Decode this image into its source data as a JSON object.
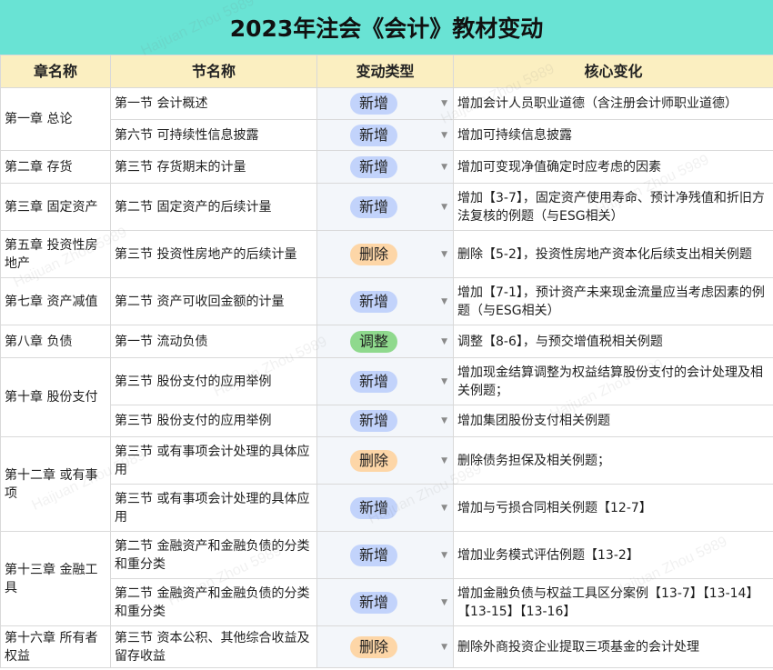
{
  "title": "2023年注会《会计》教材变动",
  "headers": [
    "章名称",
    "节名称",
    "变动类型",
    "核心变化"
  ],
  "watermark": "Haijuan Zhou 5989",
  "rows": [
    {
      "chapter": "第一章  总论",
      "rowspan": 2,
      "section": "第一节  会计概述",
      "type": "新增",
      "kind": "add",
      "change": "增加会计人员职业道德（含注册会计师职业道德）"
    },
    {
      "section": "第六节  可持续性信息披露",
      "type": "新增",
      "kind": "add",
      "change": "增加可持续信息披露"
    },
    {
      "chapter": "第二章  存货",
      "rowspan": 1,
      "section": "第三节  存货期末的计量",
      "type": "新增",
      "kind": "add",
      "change": "增加可变现净值确定时应考虑的因素"
    },
    {
      "chapter": "第三章  固定资产",
      "rowspan": 1,
      "section": "第二节   固定资产的后续计量",
      "type": "新增",
      "kind": "add",
      "change": "增加【3-7】，固定资产使用寿命、预计净残值和折旧方法复核的例题（与ESG相关）"
    },
    {
      "chapter": "第五章  投资性房地产",
      "rowspan": 1,
      "section": "第三节  投资性房地产的后续计量",
      "type": "删除",
      "kind": "del",
      "change": "删除【5-2】，投资性房地产资本化后续支出相关例题"
    },
    {
      "chapter": "第七章  资产减值",
      "rowspan": 1,
      "section": "第二节   资产可收回金额的计量",
      "type": "新增",
      "kind": "add",
      "change": "增加【7-1】，预计资产未来现金流量应当考虑因素的例题（与ESG相关）"
    },
    {
      "chapter": "第八章  负债",
      "rowspan": 1,
      "section": "第一节  流动负债",
      "type": "调整",
      "kind": "adj",
      "change": "调整【8-6】，与预交增值税相关例题"
    },
    {
      "chapter": "第十章  股份支付",
      "rowspan": 2,
      "section": "第三节  股份支付的应用举例",
      "type": "新增",
      "kind": "add",
      "change": "增加现金结算调整为权益结算股份支付的会计处理及相关例题；"
    },
    {
      "section": "第三节  股份支付的应用举例",
      "type": "新增",
      "kind": "add",
      "change": "增加集团股份支付相关例题"
    },
    {
      "chapter": "第十二章  或有事项",
      "rowspan": 2,
      "section": "第三节  或有事项会计处理的具体应用",
      "type": "删除",
      "kind": "del",
      "change": "删除债务担保及相关例题；"
    },
    {
      "section": "第三节  或有事项会计处理的具体应用",
      "type": "新增",
      "kind": "add",
      "change": "增加与亏损合同相关例题【12-7】"
    },
    {
      "chapter": "第十三章  金融工具",
      "rowspan": 2,
      "section": "第二节  金融资产和金融负债的分类和重分类",
      "type": "新增",
      "kind": "add",
      "change": "增加业务模式评估例题【13-2】"
    },
    {
      "section": "第二节  金融资产和金融负债的分类和重分类",
      "type": "新增",
      "kind": "add",
      "change": "增加金融负债与权益工具区分案例【13-7】【13-14】【13-15】【13-16】"
    },
    {
      "chapter": "第十六章  所有者权益",
      "rowspan": 1,
      "section": "第三节  资本公积、其他综合收益及留存收益",
      "type": "删除",
      "kind": "del",
      "change": "删除外商投资企业提取三项基金的会计处理"
    }
  ]
}
